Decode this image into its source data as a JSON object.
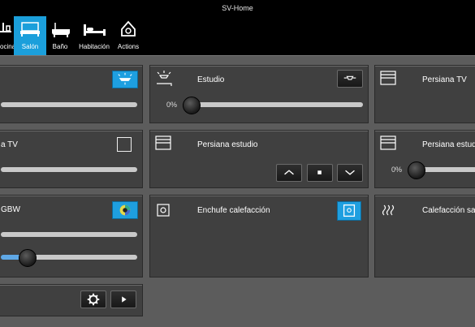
{
  "window": {
    "title": "SV-Home"
  },
  "nav": {
    "tabs": [
      {
        "label": "ocina",
        "icon": "kitchen-icon",
        "active": false
      },
      {
        "label": "Salón",
        "icon": "sofa-icon",
        "active": true
      },
      {
        "label": "Baño",
        "icon": "bathtub-icon",
        "active": false
      },
      {
        "label": "Habitación",
        "icon": "bed-icon",
        "active": false
      },
      {
        "label": "Actions",
        "icon": "home-icon",
        "active": false
      }
    ]
  },
  "cards": {
    "light_left": {
      "slider_value": 1.0
    },
    "estudio": {
      "title": "Estudio",
      "percent": "0%",
      "slider_value": 0.0
    },
    "persiana_tv_right": {
      "title": "Persiana TV"
    },
    "persiana_tv_left": {
      "title": "a TV"
    },
    "persiana_estudio": {
      "title": "Persiana estudio"
    },
    "persiana_estudio_right": {
      "title": "Persiana estudi",
      "percent": "0%",
      "slider_value": 0.0
    },
    "rgbw": {
      "title": "GBW",
      "slider_value": 0.12
    },
    "enchufe": {
      "title": "Enchufe calefacción"
    },
    "calefaccion": {
      "title": "Calefacción sal"
    }
  },
  "colors": {
    "accent": "#1e9fe0",
    "card": "#404040",
    "background": "#5c5c5c"
  }
}
